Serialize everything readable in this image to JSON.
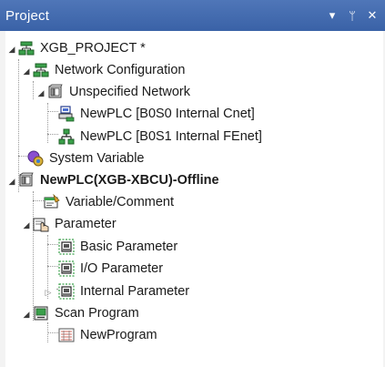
{
  "panel": {
    "title": "Project",
    "controls": {
      "dropdown": "▾",
      "pin": "ᛘ",
      "close": "✕"
    }
  },
  "tree": [
    {
      "label": "XGB_PROJECT *",
      "icon": "project-icon",
      "expanded": true
    },
    {
      "label": "Network Configuration",
      "icon": "network-configuration-icon",
      "expanded": true
    },
    {
      "label": "Unspecified Network",
      "icon": "network-folder-icon",
      "expanded": true
    },
    {
      "label": "NewPLC [B0S0 Internal Cnet]",
      "icon": "cnet-port-icon"
    },
    {
      "label": "NewPLC [B0S1 Internal FEnet]",
      "icon": "fenet-network-icon"
    },
    {
      "label": "System Variable",
      "icon": "system-variable-icon"
    },
    {
      "label": "NewPLC(XGB-XBCU)-Offline",
      "icon": "plc-icon",
      "expanded": true,
      "bold": true
    },
    {
      "label": "Variable/Comment",
      "icon": "variable-comment-icon"
    },
    {
      "label": "Parameter",
      "icon": "parameter-icon",
      "expanded": true
    },
    {
      "label": "Basic Parameter",
      "icon": "basic-parameter-icon"
    },
    {
      "label": "I/O Parameter",
      "icon": "io-parameter-icon"
    },
    {
      "label": "Internal Parameter",
      "icon": "internal-parameter-icon",
      "expanded": false
    },
    {
      "label": "Scan Program",
      "icon": "scan-program-icon",
      "expanded": true
    },
    {
      "label": "NewProgram",
      "icon": "program-icon"
    }
  ],
  "colors": {
    "titlebar": "#4a70b3",
    "panel_background": "#ffffff"
  }
}
